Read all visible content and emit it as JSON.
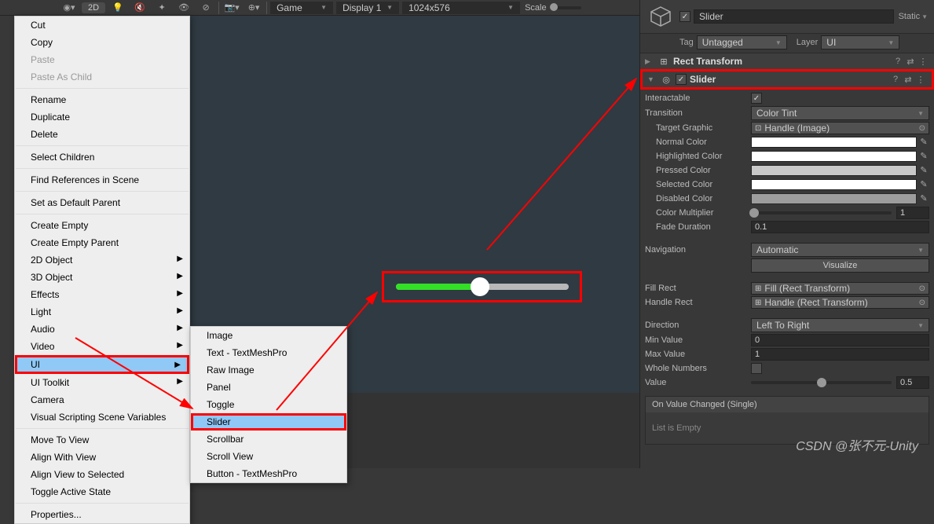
{
  "toolbar": {
    "btn_2d": "2D",
    "view_tab": "Game",
    "display": "Display 1",
    "resolution": "1024x576",
    "scale_label": "Scale"
  },
  "context_menu": {
    "cut": "Cut",
    "copy": "Copy",
    "paste": "Paste",
    "paste_as_child": "Paste As Child",
    "rename": "Rename",
    "duplicate": "Duplicate",
    "delete": "Delete",
    "select_children": "Select Children",
    "find_refs": "Find References in Scene",
    "set_default_parent": "Set as Default Parent",
    "create_empty": "Create Empty",
    "create_empty_parent": "Create Empty Parent",
    "obj_2d": "2D Object",
    "obj_3d": "3D Object",
    "effects": "Effects",
    "light": "Light",
    "audio": "Audio",
    "video": "Video",
    "ui": "UI",
    "ui_toolkit": "UI Toolkit",
    "camera": "Camera",
    "visual_scripting": "Visual Scripting Scene Variables",
    "move_to_view": "Move To View",
    "align_with_view": "Align With View",
    "align_view_to": "Align View to Selected",
    "toggle_active": "Toggle Active State",
    "properties": "Properties..."
  },
  "ui_submenu": {
    "image": "Image",
    "text": "Text - TextMeshPro",
    "raw_image": "Raw Image",
    "panel": "Panel",
    "toggle": "Toggle",
    "slider": "Slider",
    "scrollbar": "Scrollbar",
    "scroll_view": "Scroll View",
    "button_tmp": "Button - TextMeshPro"
  },
  "inspector": {
    "name": "Slider",
    "static_label": "Static",
    "tag_label": "Tag",
    "tag_value": "Untagged",
    "layer_label": "Layer",
    "layer_value": "UI",
    "rect_transform": "Rect Transform",
    "slider_component": "Slider",
    "props": {
      "interactable": "Interactable",
      "transition": "Transition",
      "transition_val": "Color Tint",
      "target_graphic": "Target Graphic",
      "target_graphic_val": "Handle (Image)",
      "normal_color": "Normal Color",
      "highlighted_color": "Highlighted Color",
      "pressed_color": "Pressed Color",
      "selected_color": "Selected Color",
      "disabled_color": "Disabled Color",
      "color_multiplier": "Color Multiplier",
      "color_multiplier_val": "1",
      "fade_duration": "Fade Duration",
      "fade_duration_val": "0.1",
      "navigation": "Navigation",
      "navigation_val": "Automatic",
      "visualize": "Visualize",
      "fill_rect": "Fill Rect",
      "fill_rect_val": "Fill (Rect Transform)",
      "handle_rect": "Handle Rect",
      "handle_rect_val": "Handle (Rect Transform)",
      "direction": "Direction",
      "direction_val": "Left To Right",
      "min_value": "Min Value",
      "min_value_val": "0",
      "max_value": "Max Value",
      "max_value_val": "1",
      "whole_numbers": "Whole Numbers",
      "value": "Value",
      "value_val": "0.5",
      "on_value_changed": "On Value Changed (Single)",
      "list_empty": "List is Empty"
    }
  },
  "watermark": "CSDN @张不元-Unity"
}
